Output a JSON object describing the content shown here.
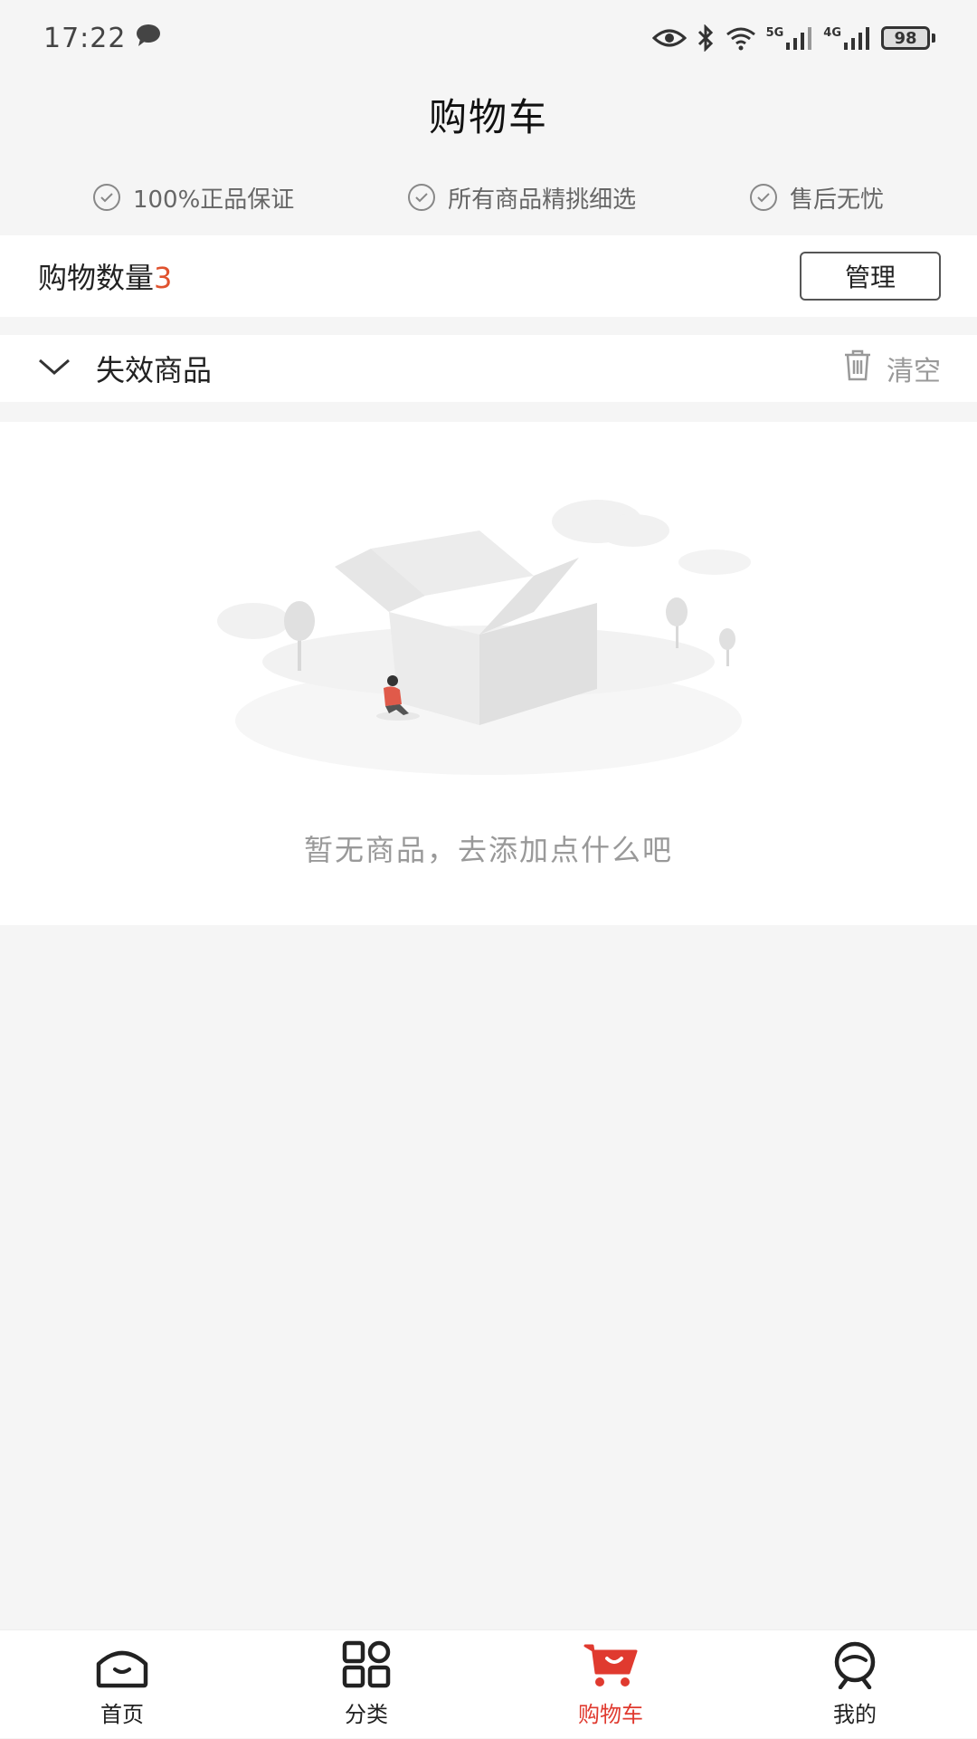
{
  "status_bar": {
    "time": "17:22",
    "network_5g": "5G",
    "network_4g": "4G",
    "battery": "98"
  },
  "header": {
    "title": "购物车"
  },
  "guarantees": [
    {
      "label": "100%正品保证",
      "icon": "check-circle-icon"
    },
    {
      "label": "所有商品精挑细选",
      "icon": "check-circle-icon"
    },
    {
      "label": "售后无忧",
      "icon": "check-circle-icon"
    }
  ],
  "cart_summary": {
    "count_label": "购物数量",
    "count": "3",
    "manage_label": "管理"
  },
  "invalid_section": {
    "title": "失效商品",
    "clear_label": "清空"
  },
  "empty_state": {
    "message": "暂无商品，去添加点什么吧"
  },
  "tab_bar": {
    "items": [
      {
        "label": "首页",
        "icon": "home-icon",
        "active": false
      },
      {
        "label": "分类",
        "icon": "category-icon",
        "active": false
      },
      {
        "label": "购物车",
        "icon": "cart-icon",
        "active": true
      },
      {
        "label": "我的",
        "icon": "profile-icon",
        "active": false
      }
    ]
  },
  "colors": {
    "accent": "#e03a2f",
    "count_highlight": "#e0522e",
    "background": "#f5f5f5"
  }
}
